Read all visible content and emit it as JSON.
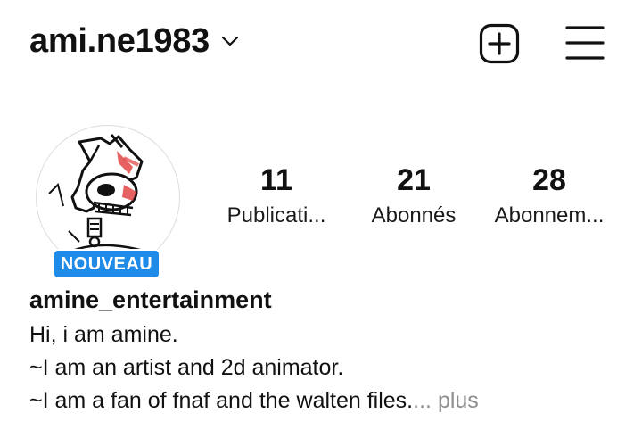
{
  "header": {
    "username": "ami.ne1983"
  },
  "profile": {
    "new_badge": "NOUVEAU",
    "display_name": "amine_entertainment",
    "bio": {
      "line1": "Hi, i am amine.",
      "line2": "~I am an artist and 2d animator.",
      "line3": "~I am a fan of fnaf and the walten files.",
      "ellipsis": "...",
      "more": "plus"
    }
  },
  "stats": {
    "posts": {
      "value": "11",
      "label": "Publicati..."
    },
    "followers": {
      "value": "21",
      "label": "Abonnés"
    },
    "following": {
      "value": "28",
      "label": "Abonnem..."
    }
  },
  "icons": {
    "dropdown": "chevron-down-icon",
    "add": "plus-square-icon",
    "menu": "hamburger-menu-icon"
  },
  "colors": {
    "badge": "#1e8be8",
    "text": "#111111",
    "muted": "#8e8e8e",
    "accent_red": "#e03a3a"
  }
}
